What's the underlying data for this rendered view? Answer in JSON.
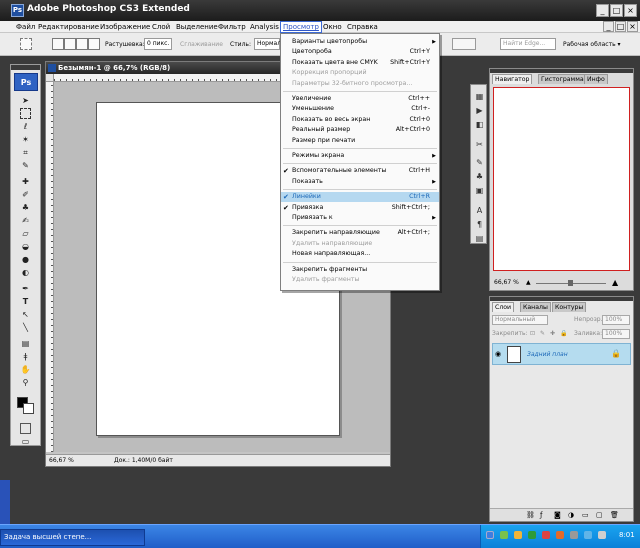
{
  "title_bar": {
    "logo": "Ps",
    "title": "Adobe Photoshop CS3 Extended",
    "minimize": "_",
    "maximize": "□",
    "close": "×"
  },
  "menubar": [
    "Файл",
    "Редактирование",
    "Изображение",
    "Слой",
    "Выделение",
    "Фильтр",
    "Analysis",
    "Просмотр",
    "Окно",
    "Справка"
  ],
  "options_bar": {
    "feather_label": "Растушевка:",
    "feather_value": "0 пикс.",
    "smoothing_label": "Сглаживание",
    "style_label": "Стиль:",
    "style_value": "Нормал",
    "search_placeholder": "Найти Edge...",
    "workspace_label": "Рабочая область ▾"
  },
  "toolbox": {
    "badge": "Ps"
  },
  "document": {
    "title": "Безымян-1 @ 66,7% (RGB/8)",
    "zoom": "66,67 %",
    "doc_info": "Док.: 1,40М/0 байт"
  },
  "view_menu": {
    "items": [
      {
        "label": "Варианты цветопробы",
        "shortcut": "",
        "submenu": true,
        "disabled": false,
        "checked": false
      },
      {
        "label": "Цветопроба",
        "shortcut": "Ctrl+Y",
        "submenu": false,
        "disabled": false,
        "checked": false
      },
      {
        "label": "Показать цвета вне CMYK",
        "shortcut": "Shift+Ctrl+Y",
        "submenu": false,
        "disabled": false,
        "checked": false
      },
      {
        "label": "Коррекция пропорций",
        "shortcut": "",
        "submenu": false,
        "disabled": true,
        "checked": false
      },
      {
        "label": "Параметры 32-битного просмотра...",
        "shortcut": "",
        "submenu": false,
        "disabled": true,
        "checked": false
      },
      {
        "label": "Увеличение",
        "shortcut": "Ctrl++",
        "submenu": false,
        "disabled": false,
        "checked": false
      },
      {
        "label": "Уменьшение",
        "shortcut": "Ctrl+-",
        "submenu": false,
        "disabled": false,
        "checked": false
      },
      {
        "label": "Показать во весь экран",
        "shortcut": "Ctrl+0",
        "submenu": false,
        "disabled": false,
        "checked": false
      },
      {
        "label": "Реальный размер",
        "shortcut": "Alt+Ctrl+0",
        "submenu": false,
        "disabled": false,
        "checked": false
      },
      {
        "label": "Размер при печати",
        "shortcut": "",
        "submenu": false,
        "disabled": false,
        "checked": false
      },
      {
        "label": "Режимы экрана",
        "shortcut": "",
        "submenu": true,
        "disabled": false,
        "checked": false
      },
      {
        "label": "Вспомогательные элементы",
        "shortcut": "Ctrl+H",
        "submenu": false,
        "disabled": false,
        "checked": true
      },
      {
        "label": "Показать",
        "shortcut": "",
        "submenu": true,
        "disabled": false,
        "checked": false
      },
      {
        "label": "Линейки",
        "shortcut": "Ctrl+R",
        "submenu": false,
        "disabled": false,
        "checked": true,
        "highlighted": true
      },
      {
        "label": "Привязка",
        "shortcut": "Shift+Ctrl+;",
        "submenu": false,
        "disabled": false,
        "checked": true
      },
      {
        "label": "Привязать к",
        "shortcut": "",
        "submenu": true,
        "disabled": false,
        "checked": false
      },
      {
        "label": "Закрепить направляющие",
        "shortcut": "Alt+Ctrl+;",
        "submenu": false,
        "disabled": false,
        "checked": false
      },
      {
        "label": "Удалить направляющие",
        "shortcut": "",
        "submenu": false,
        "disabled": true,
        "checked": false
      },
      {
        "label": "Новая направляющая...",
        "shortcut": "",
        "submenu": false,
        "disabled": false,
        "checked": false
      },
      {
        "label": "Закрепить фрагменты",
        "shortcut": "",
        "submenu": false,
        "disabled": false,
        "checked": false
      },
      {
        "label": "Удалить фрагменты",
        "shortcut": "",
        "submenu": false,
        "disabled": true,
        "checked": false
      }
    ]
  },
  "navigator_panel": {
    "tabs": [
      "Навигатор",
      "Гистограмма",
      "Инфо"
    ],
    "zoom": "66,67 %"
  },
  "layers_panel": {
    "tabs": [
      "Слои",
      "Каналы",
      "Контуры"
    ],
    "blend_mode": "Нормальный",
    "opacity_label": "Непрозр.:",
    "opacity_value": "100%",
    "lock_label": "Закрепить:",
    "fill_label": "Заливка:",
    "fill_value": "100%",
    "layer_name": "Задний план"
  },
  "taskbar": {
    "task_label": "Задача высшей степе...",
    "clock": "8:01"
  }
}
